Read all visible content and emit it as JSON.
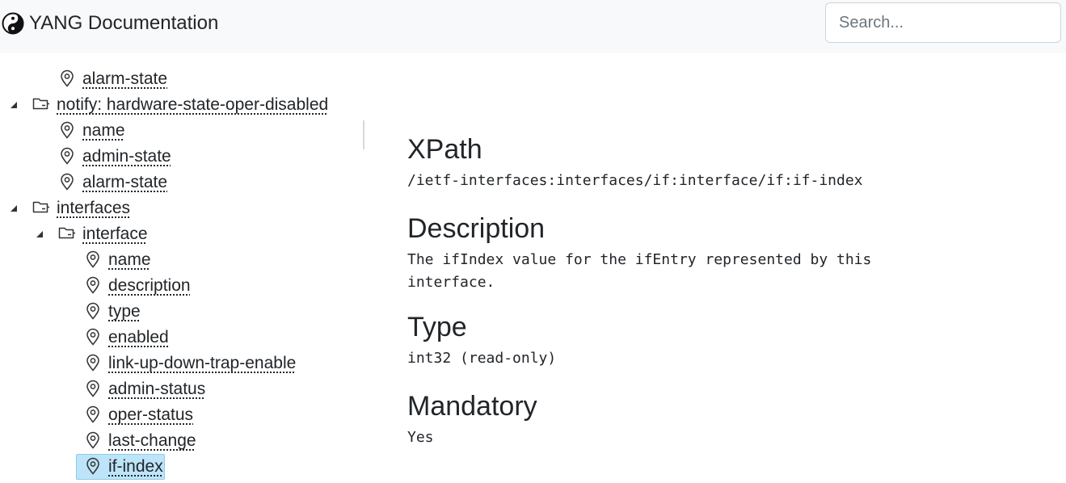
{
  "navbar": {
    "brand_icon": "yin-yang-icon",
    "title": "YANG Documentation",
    "search_placeholder": "Search..."
  },
  "tree": {
    "rows": [
      {
        "label": "alarm-state",
        "kind": "leaf",
        "depth": 2
      },
      {
        "label": "notify: hardware-state-oper-disabled",
        "kind": "container",
        "depth": 1,
        "expanded": true
      },
      {
        "label": "name",
        "kind": "leaf",
        "depth": 2
      },
      {
        "label": "admin-state",
        "kind": "leaf",
        "depth": 2
      },
      {
        "label": "alarm-state",
        "kind": "leaf",
        "depth": 2
      },
      {
        "label": "interfaces",
        "kind": "container",
        "depth": 1,
        "expanded": true
      },
      {
        "label": "interface",
        "kind": "container",
        "depth": 2,
        "expanded": true
      },
      {
        "label": "name",
        "kind": "leaf",
        "depth": 3
      },
      {
        "label": "description",
        "kind": "leaf",
        "depth": 3
      },
      {
        "label": "type",
        "kind": "leaf",
        "depth": 3
      },
      {
        "label": "enabled",
        "kind": "leaf",
        "depth": 3
      },
      {
        "label": "link-up-down-trap-enable",
        "kind": "leaf",
        "depth": 3
      },
      {
        "label": "admin-status",
        "kind": "leaf",
        "depth": 3
      },
      {
        "label": "oper-status",
        "kind": "leaf",
        "depth": 3
      },
      {
        "label": "last-change",
        "kind": "leaf",
        "depth": 3
      },
      {
        "label": "if-index",
        "kind": "leaf",
        "depth": 3,
        "selected": true
      }
    ]
  },
  "detail": {
    "xpath_heading": "XPath",
    "xpath_value": "/ietf-interfaces:interfaces/if:interface/if:if-index",
    "description_heading": "Description",
    "description_value": "The ifIndex value for the ifEntry represented by this\ninterface.",
    "type_heading": "Type",
    "type_value": "int32 (read-only)",
    "mandatory_heading": "Mandatory",
    "mandatory_value": "Yes"
  },
  "colors": {
    "navbar_bg": "#f8f9fa",
    "selected_bg": "#bde4f8",
    "text": "#212529"
  }
}
